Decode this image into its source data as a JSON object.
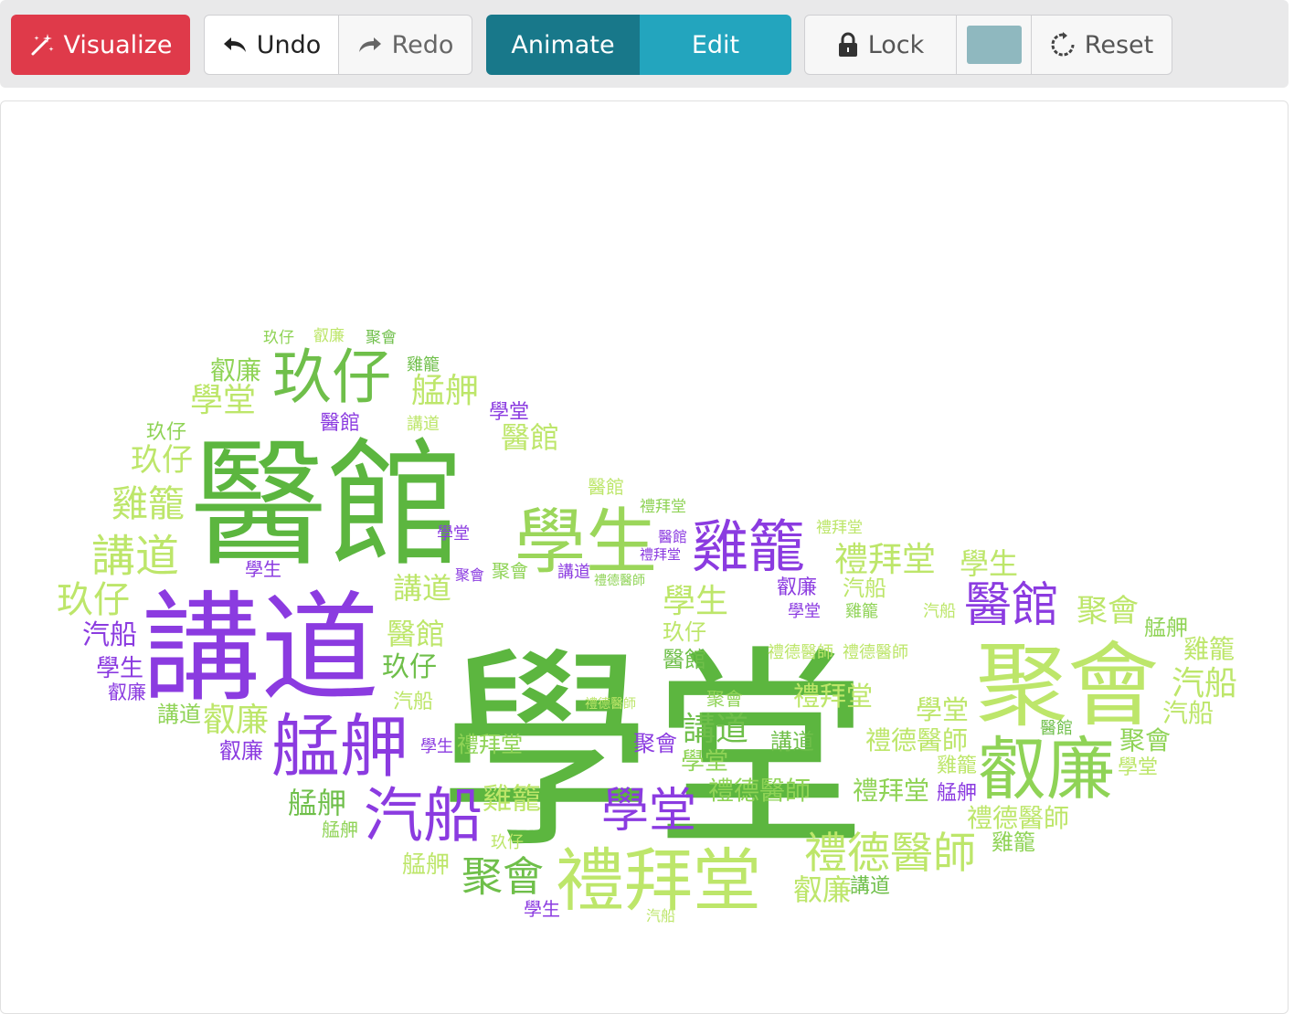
{
  "toolbar": {
    "visualize_label": "Visualize",
    "undo_label": "Undo",
    "redo_label": "Redo",
    "animate_label": "Animate",
    "edit_label": "Edit",
    "lock_label": "Lock",
    "reset_label": "Reset",
    "swatch_color": "#8fb8bf",
    "icons": [
      "magic-wand-icon",
      "undo-icon",
      "redo-icon",
      "lock-icon",
      "reset-icon"
    ]
  },
  "colors": {
    "visualize_bg": "#df3a4a",
    "animate_bg": "#18788a",
    "edit_bg": "#23a5be",
    "cloud_green": "#5cb63f",
    "cloud_light": "#bde66a",
    "cloud_purple": "#8b3be0"
  },
  "word_cloud": {
    "words": [
      {
        "text": "學堂",
        "color": "#5cb63f"
      },
      {
        "text": "醫館",
        "color": "#5cb63f"
      },
      {
        "text": "講道",
        "color": "#8b3be0"
      },
      {
        "text": "聚會",
        "color": "#bde66a"
      },
      {
        "text": "學生",
        "color": "#9bd65a"
      },
      {
        "text": "禮拜堂",
        "color": "#bde66a"
      },
      {
        "text": "叡廉",
        "color": "#8fd356"
      },
      {
        "text": "艋舺",
        "color": "#8b3be0"
      },
      {
        "text": "汽船",
        "color": "#8b3be0"
      },
      {
        "text": "玖仔",
        "color": "#6fbf4a"
      },
      {
        "text": "雞籠",
        "color": "#8b3be0"
      },
      {
        "text": "禮德醫師",
        "color": "#bde66a"
      }
    ]
  }
}
